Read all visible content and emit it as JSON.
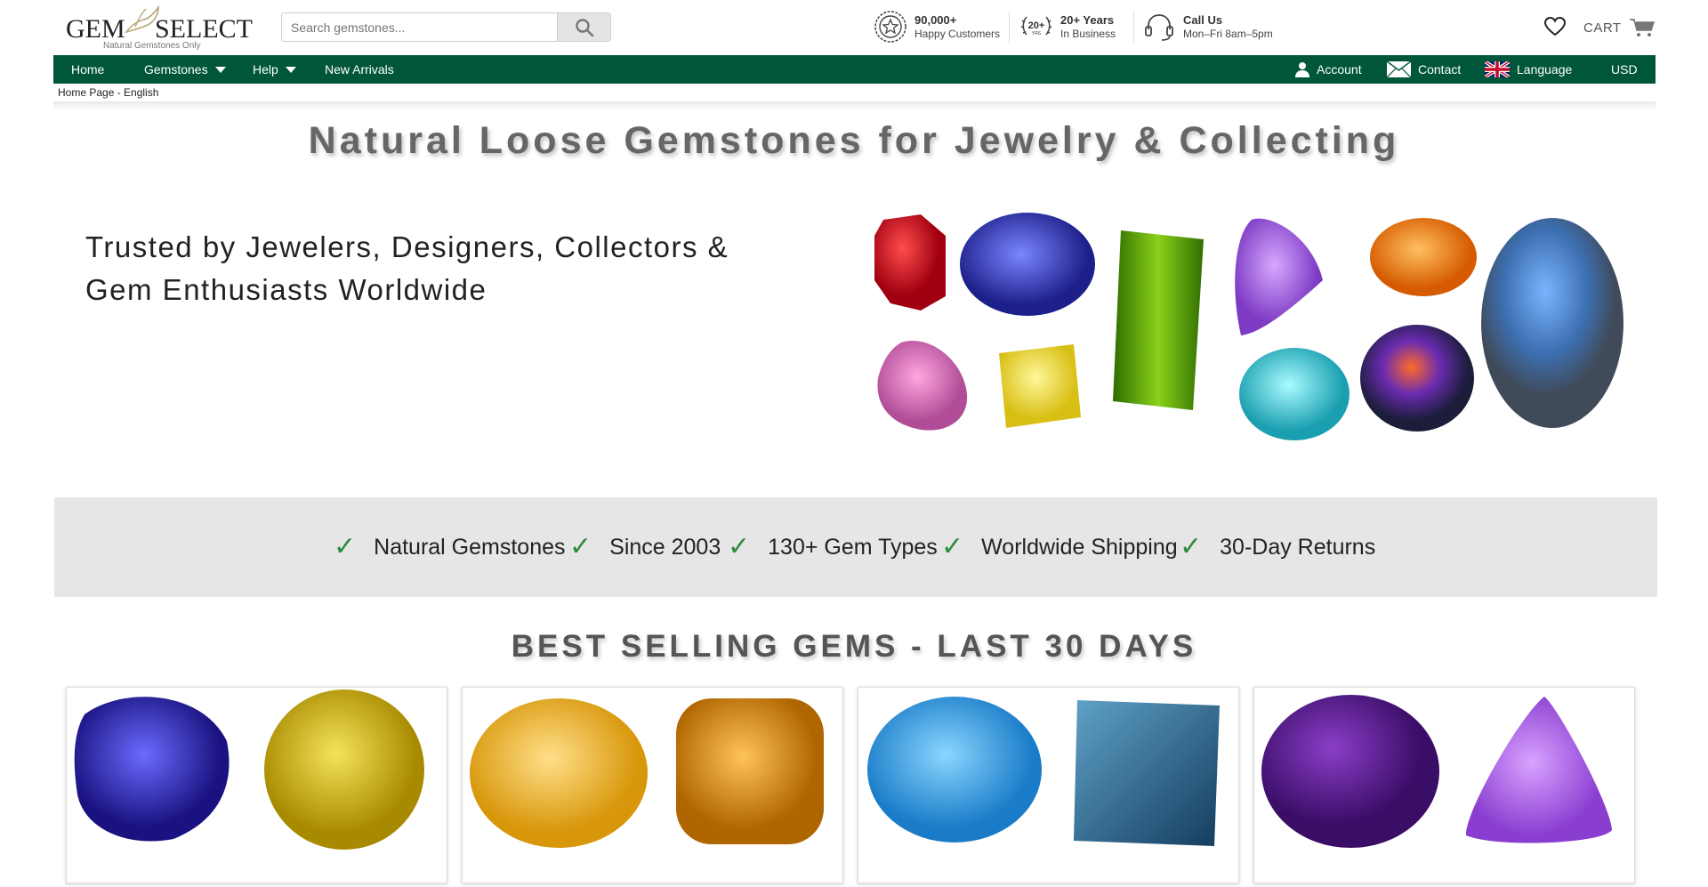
{
  "header": {
    "logo": {
      "brand_left": "GEM",
      "brand_right": "SELECT",
      "tagline": "Natural Gemstones Only"
    },
    "search": {
      "placeholder": "Search gemstones..."
    },
    "trust": [
      {
        "title": "90,000+",
        "subtitle": "Happy Customers",
        "icon": "award-badge-icon"
      },
      {
        "title": "20+ Years",
        "subtitle": "In Business",
        "icon": "laurel-20-yrs-icon"
      },
      {
        "title": "Call Us",
        "subtitle": "Mon–Fri 8am–5pm",
        "icon": "headset-icon"
      }
    ],
    "trust_badge_text": "20+",
    "trust_badge_sub": "YRS",
    "cart_label": "CART"
  },
  "nav": {
    "items": [
      {
        "label": "Home"
      },
      {
        "label": "Gemstones",
        "dropdown": true
      },
      {
        "label": "Help",
        "dropdown": true
      },
      {
        "label": "New Arrivals"
      }
    ],
    "right": [
      {
        "label": "Account",
        "icon": "user-icon"
      },
      {
        "label": "Contact",
        "icon": "envelope-icon"
      },
      {
        "label": "Language",
        "icon": "uk-flag-icon"
      },
      {
        "label": "USD"
      }
    ],
    "color": "#00563b"
  },
  "breadcrumb": "Home Page - English",
  "hero": {
    "title": "Natural Loose Gemstones for Jewelry & Collecting",
    "subtitle": "Trusted by Jewelers, Designers, Collectors & Gem Enthusiasts Worldwide",
    "image": "assorted-gemstones-banner"
  },
  "features": [
    {
      "label": "Natural Gemstones"
    },
    {
      "label": "Since 2003"
    },
    {
      "label": "130+ Gem Types"
    },
    {
      "label": "Worldwide Shipping"
    },
    {
      "label": "30-Day Returns"
    }
  ],
  "feature_icon": "check-icon",
  "best_selling": {
    "title": "BEST SELLING GEMS - LAST 30 DAYS",
    "cards": [
      {
        "gems": [
          "tanzanite-trillion",
          "yellow-sapphire-round"
        ]
      },
      {
        "gems": [
          "citrine-oval",
          "citrine-cushion"
        ]
      },
      {
        "gems": [
          "swiss-blue-topaz-oval",
          "london-blue-topaz-square"
        ]
      },
      {
        "gems": [
          "amethyst-cabochon",
          "amethyst-trillion"
        ]
      }
    ]
  }
}
